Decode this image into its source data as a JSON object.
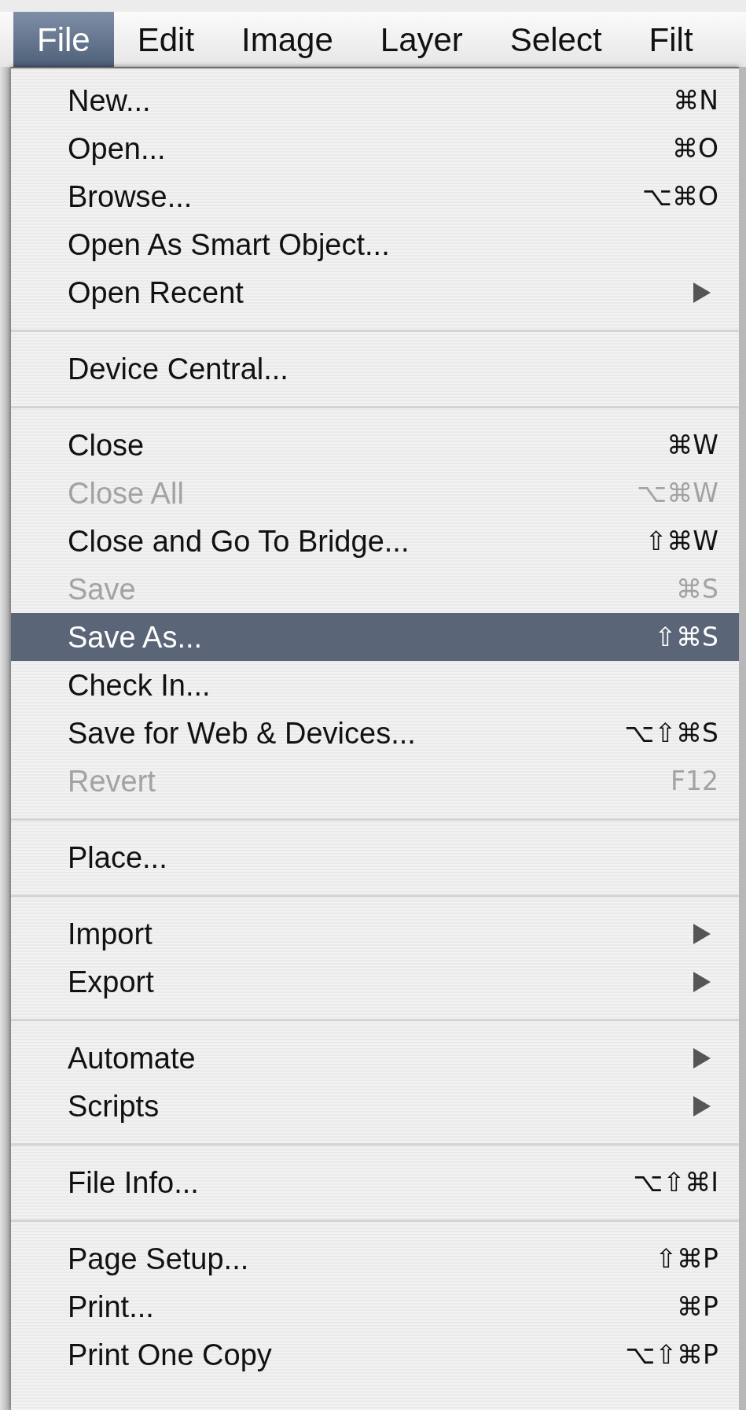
{
  "menu_bar": {
    "items": [
      {
        "label": "File",
        "selected": true
      },
      {
        "label": "Edit",
        "selected": false
      },
      {
        "label": "Image",
        "selected": false
      },
      {
        "label": "Layer",
        "selected": false
      },
      {
        "label": "Select",
        "selected": false
      },
      {
        "label": "Filt",
        "selected": false
      }
    ]
  },
  "menu": {
    "entries": [
      {
        "kind": "item",
        "label": "New...",
        "shortcut": "⌘N",
        "disabled": false,
        "selected": false,
        "submenu": false
      },
      {
        "kind": "item",
        "label": "Open...",
        "shortcut": "⌘O",
        "disabled": false,
        "selected": false,
        "submenu": false
      },
      {
        "kind": "item",
        "label": "Browse...",
        "shortcut": "⌥⌘O",
        "disabled": false,
        "selected": false,
        "submenu": false
      },
      {
        "kind": "item",
        "label": "Open As Smart Object...",
        "disabled": false,
        "selected": false,
        "submenu": false
      },
      {
        "kind": "item",
        "label": "Open Recent",
        "disabled": false,
        "selected": false,
        "submenu": true
      },
      {
        "kind": "separator"
      },
      {
        "kind": "item",
        "label": "Device Central...",
        "disabled": false,
        "selected": false,
        "submenu": false
      },
      {
        "kind": "separator"
      },
      {
        "kind": "item",
        "label": "Close",
        "shortcut": "⌘W",
        "disabled": false,
        "selected": false,
        "submenu": false
      },
      {
        "kind": "item",
        "label": "Close All",
        "shortcut": "⌥⌘W",
        "disabled": true,
        "selected": false,
        "submenu": false
      },
      {
        "kind": "item",
        "label": "Close and Go To Bridge...",
        "shortcut": "⇧⌘W",
        "disabled": false,
        "selected": false,
        "submenu": false
      },
      {
        "kind": "item",
        "label": "Save",
        "shortcut": "⌘S",
        "disabled": true,
        "selected": false,
        "submenu": false
      },
      {
        "kind": "item",
        "label": "Save As...",
        "shortcut": "⇧⌘S",
        "disabled": false,
        "selected": true,
        "submenu": false
      },
      {
        "kind": "item",
        "label": "Check In...",
        "disabled": false,
        "selected": false,
        "submenu": false
      },
      {
        "kind": "item",
        "label": "Save for Web & Devices...",
        "shortcut": "⌥⇧⌘S",
        "disabled": false,
        "selected": false,
        "submenu": false
      },
      {
        "kind": "item",
        "label": "Revert",
        "shortcut": "F12",
        "disabled": true,
        "selected": false,
        "submenu": false
      },
      {
        "kind": "separator"
      },
      {
        "kind": "item",
        "label": "Place...",
        "disabled": false,
        "selected": false,
        "submenu": false
      },
      {
        "kind": "separator"
      },
      {
        "kind": "item",
        "label": "Import",
        "disabled": false,
        "selected": false,
        "submenu": true
      },
      {
        "kind": "item",
        "label": "Export",
        "disabled": false,
        "selected": false,
        "submenu": true
      },
      {
        "kind": "separator"
      },
      {
        "kind": "item",
        "label": "Automate",
        "disabled": false,
        "selected": false,
        "submenu": true
      },
      {
        "kind": "item",
        "label": "Scripts",
        "disabled": false,
        "selected": false,
        "submenu": true
      },
      {
        "kind": "separator"
      },
      {
        "kind": "item",
        "label": "File Info...",
        "shortcut": "⌥⇧⌘I",
        "disabled": false,
        "selected": false,
        "submenu": false
      },
      {
        "kind": "separator"
      },
      {
        "kind": "item",
        "label": "Page Setup...",
        "shortcut": "⇧⌘P",
        "disabled": false,
        "selected": false,
        "submenu": false
      },
      {
        "kind": "item",
        "label": "Print...",
        "shortcut": "⌘P",
        "disabled": false,
        "selected": false,
        "submenu": false
      },
      {
        "kind": "item",
        "label": "Print One Copy",
        "shortcut": "⌥⇧⌘P",
        "disabled": false,
        "selected": false,
        "submenu": false
      }
    ]
  }
}
